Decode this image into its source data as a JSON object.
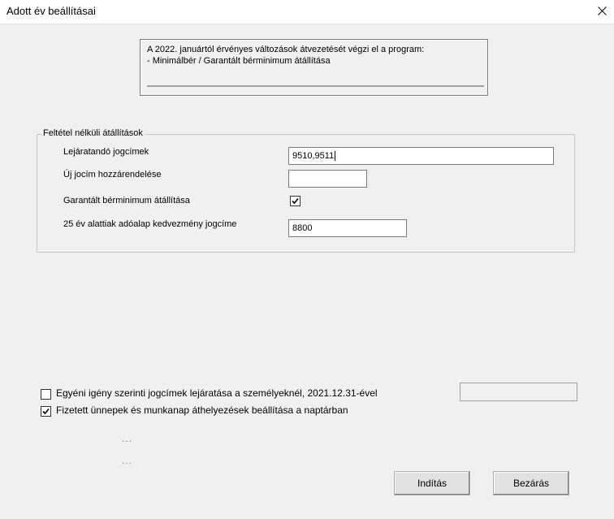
{
  "window": {
    "title": "Adott év beállításai",
    "close_icon": "close-icon"
  },
  "info": {
    "line1": "A 2022. januártól érvényes változások átvezetését végzi el a program:",
    "line2": "- Minimálbér / Garantált bérminimum átállítása"
  },
  "group": {
    "legend": "Feltétel nélküli átállítások",
    "fields": {
      "lejaratando_label": "Lejáratandó jogcímek",
      "lejaratando_value": "9510,9511",
      "uj_jocim_label": "Új jocím hozzárendelése",
      "uj_jocim_value": "",
      "garantalt_label": "Garantált bérminimum átállítása",
      "garantalt_checked": true,
      "ado_label": "25 év alattiak adóalap kedvezmény jogcíme",
      "ado_value": "8800"
    }
  },
  "options": {
    "egyeni_label": "Egyéni igény szerinti jogcímek lejáratása a személyeknél, 2021.12.31-ével",
    "egyeni_checked": false,
    "egyeni_value": "",
    "fizetett_label": "Fizetett ünnepek és munkanap áthelyezések beállítása a naptárban",
    "fizetett_checked": true
  },
  "dots": {
    "first": "...",
    "second": "..."
  },
  "buttons": {
    "start": "Indítás",
    "close": "Bezárás"
  }
}
